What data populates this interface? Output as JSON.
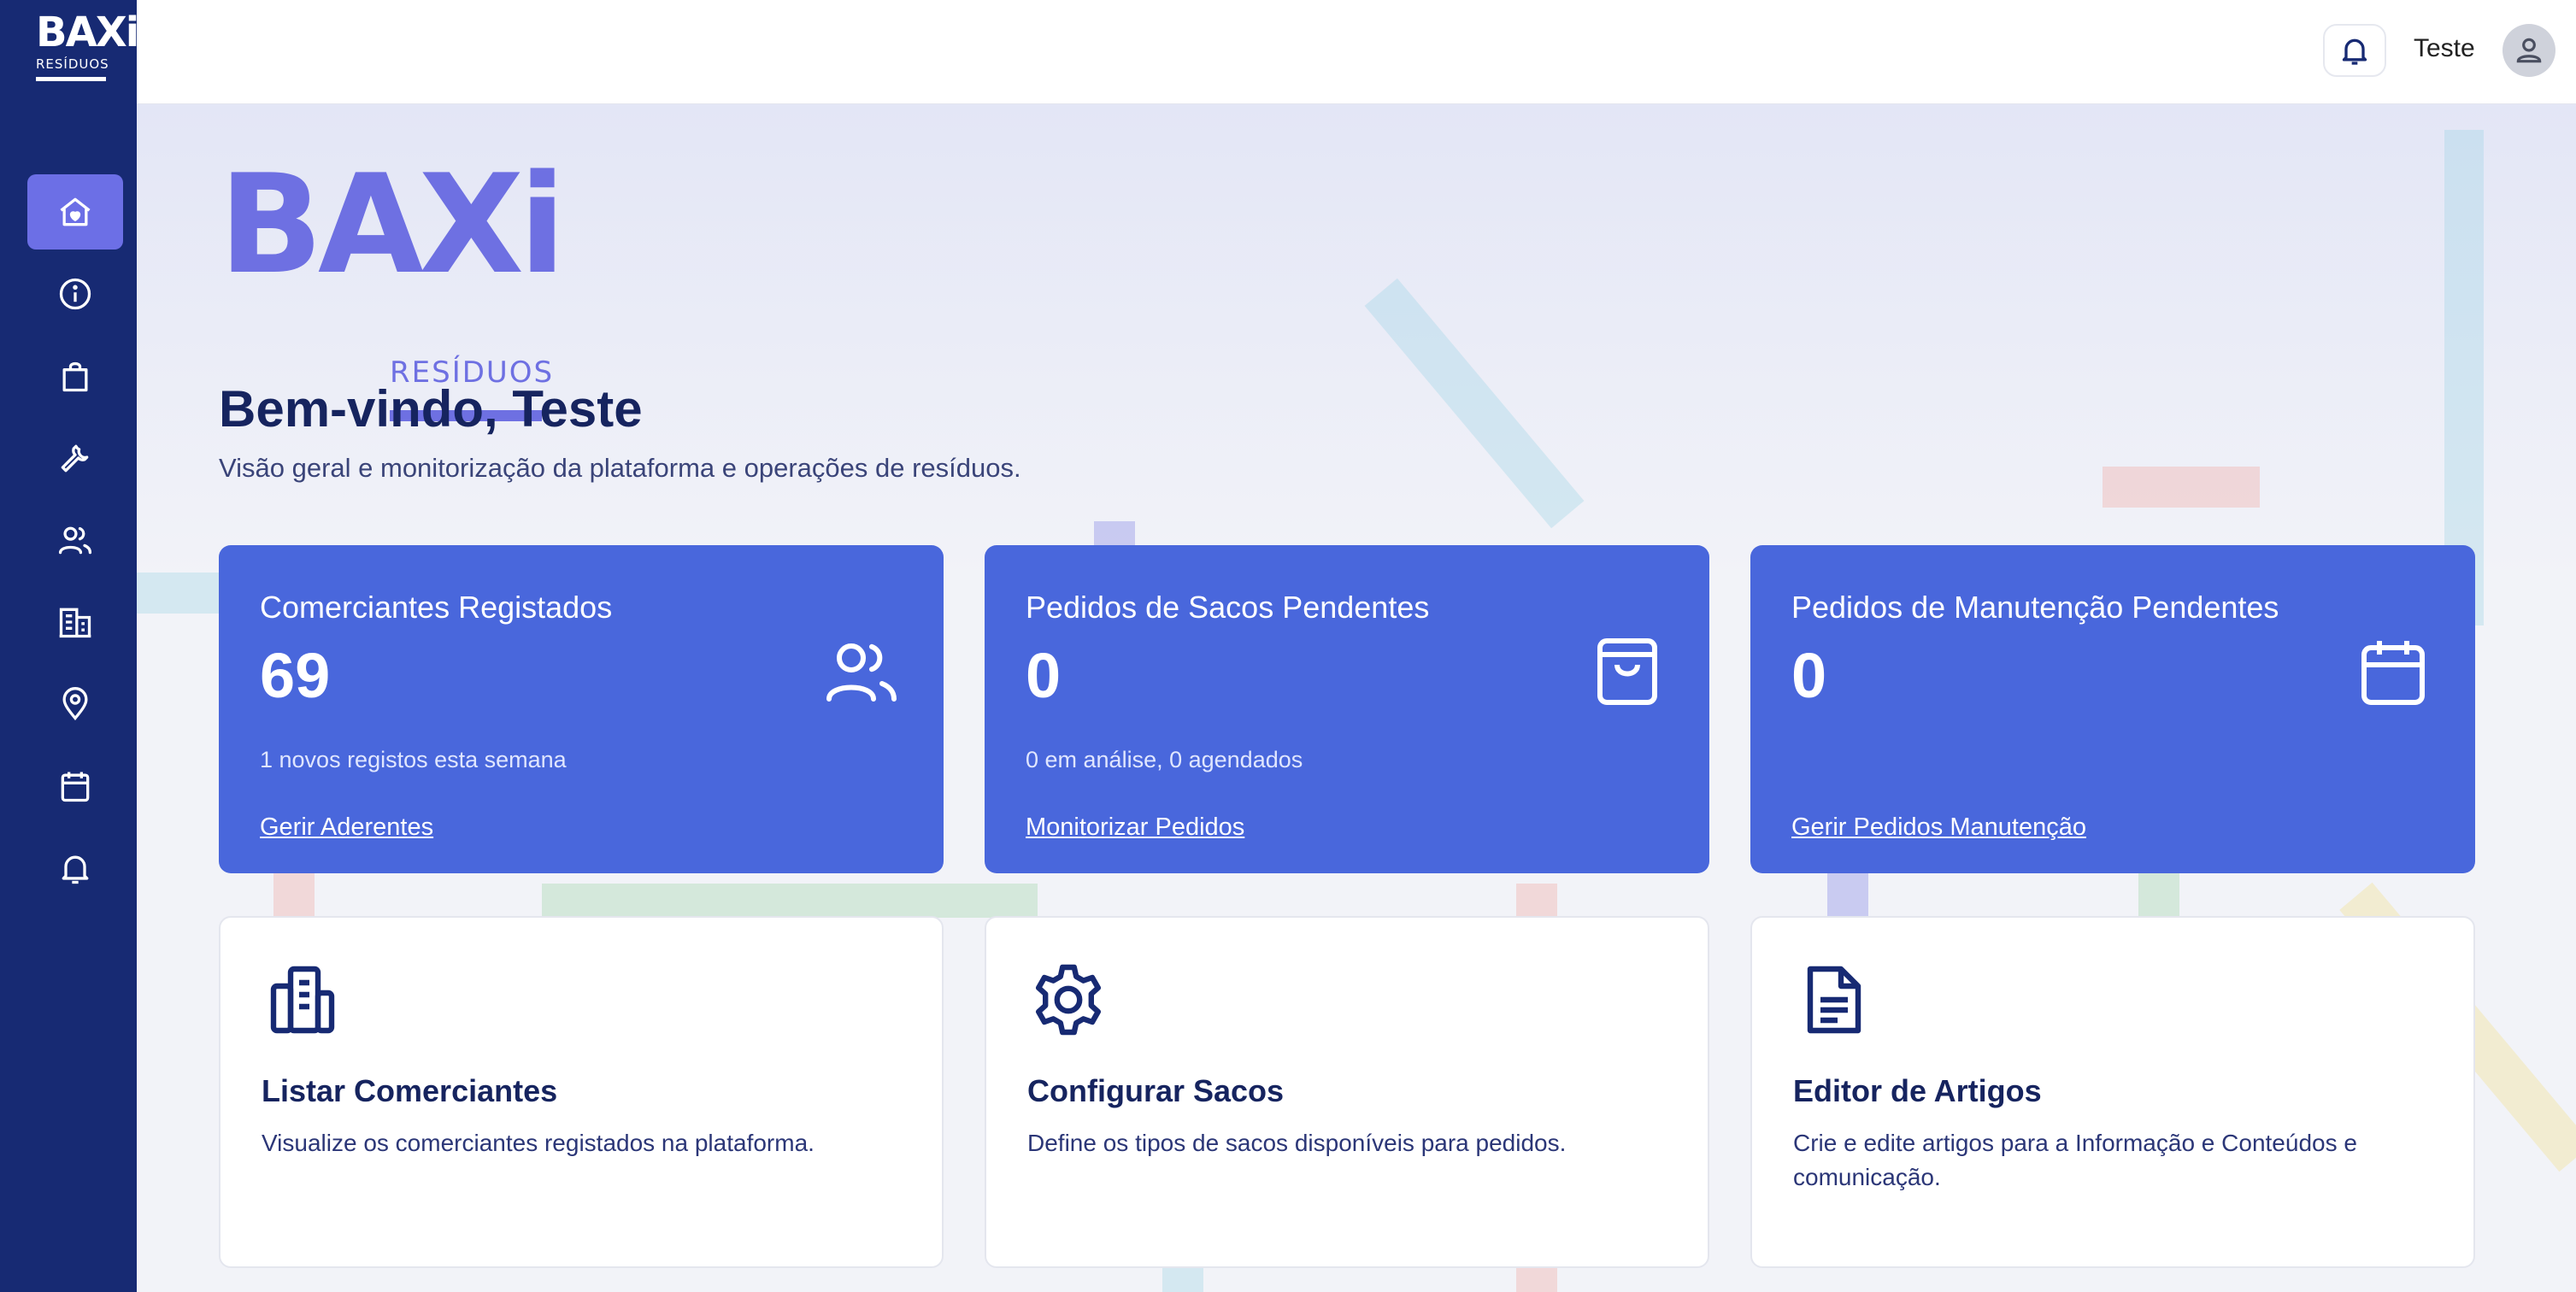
{
  "app": {
    "logo_letters": "BAXi",
    "logo_sub": "RESÍDUOS"
  },
  "sidebar": {
    "items": [
      {
        "icon": "home-icon",
        "active": true
      },
      {
        "icon": "info-icon",
        "active": false
      },
      {
        "icon": "bag-icon",
        "active": false
      },
      {
        "icon": "wrench-icon",
        "active": false
      },
      {
        "icon": "users-icon",
        "active": false
      },
      {
        "icon": "building-icon",
        "active": false
      },
      {
        "icon": "map-pin-icon",
        "active": false
      },
      {
        "icon": "calendar-icon",
        "active": false
      },
      {
        "icon": "bell-icon",
        "active": false
      }
    ]
  },
  "header": {
    "user_name": "Teste",
    "notification_icon": "bell-icon",
    "avatar_icon": "user-icon"
  },
  "main": {
    "hero_logo_letters": "BAXi",
    "hero_logo_sub": "RESÍDUOS",
    "title": "Bem-vindo, Teste",
    "subtitle": "Visão geral e monitorização da plataforma e operações de resíduos."
  },
  "stats": [
    {
      "label": "Comerciantes Registados",
      "value": "69",
      "detail": "1 novos registos esta semana",
      "link": "Gerir Aderentes",
      "icon": "users-icon"
    },
    {
      "label": "Pedidos de Sacos Pendentes",
      "value": "0",
      "detail": "0 em análise, 0 agendados",
      "link": "Monitorizar Pedidos",
      "icon": "shopping-bag-icon"
    },
    {
      "label": "Pedidos de Manutenção Pendentes",
      "value": "0",
      "detail": "",
      "link": "Gerir Pedidos Manutenção",
      "icon": "calendar-icon"
    }
  ],
  "actions": [
    {
      "title": "Listar Comerciantes",
      "description": "Visualize os comerciantes registados na plataforma.",
      "icon": "building-icon"
    },
    {
      "title": "Configurar Sacos",
      "description": "Define os tipos de sacos disponíveis para pedidos.",
      "icon": "gear-icon"
    },
    {
      "title": "Editor de Artigos",
      "description": "Crie e edite artigos para a Informação e Conteúdos e comunicação.",
      "icon": "document-icon"
    }
  ],
  "colors": {
    "sidebar": "#172a73",
    "accent": "#6c6fe6",
    "card": "#4967dc",
    "heading": "#16245f"
  }
}
